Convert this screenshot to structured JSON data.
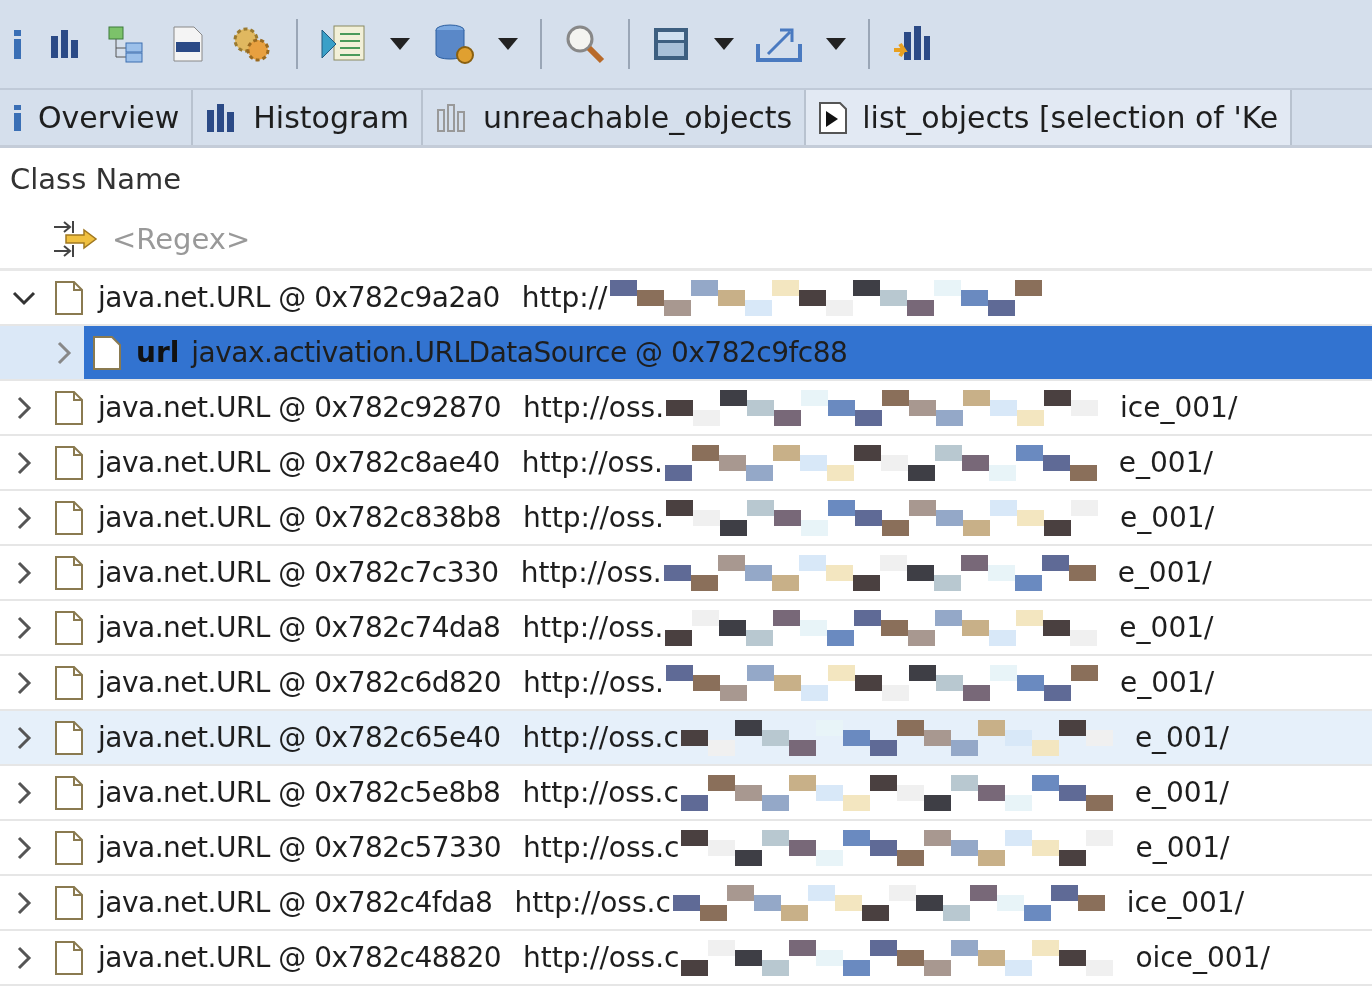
{
  "tabs": [
    {
      "kind": "info",
      "label": "Overview",
      "selected": false
    },
    {
      "kind": "histogram",
      "label": "Histogram",
      "selected": false
    },
    {
      "kind": "histogram-outline",
      "label": "unreachable_objects",
      "selected": false
    },
    {
      "kind": "list",
      "label": "list_objects [selection of 'Ke",
      "selected": true
    }
  ],
  "table": {
    "column": "Class Name",
    "filter_placeholder": "<Regex>",
    "rows": [
      {
        "name": "java.net.URL @ 0x782c9a2a0",
        "url_prefix": "http://",
        "url_suffix": "",
        "expanded": true,
        "hovered": false,
        "children": [
          {
            "field": "url",
            "name": "javax.activation.URLDataSource @ 0x782c9fc88",
            "selected": true,
            "expanded": false
          }
        ]
      },
      {
        "name": "java.net.URL @ 0x782c92870",
        "url_prefix": "http://oss.",
        "url_suffix": "ice_001/",
        "expanded": false,
        "hovered": false
      },
      {
        "name": "java.net.URL @ 0x782c8ae40",
        "url_prefix": "http://oss.",
        "url_suffix": "e_001/",
        "expanded": false,
        "hovered": false
      },
      {
        "name": "java.net.URL @ 0x782c838b8",
        "url_prefix": "http://oss.",
        "url_suffix": "e_001/",
        "expanded": false,
        "hovered": false
      },
      {
        "name": "java.net.URL @ 0x782c7c330",
        "url_prefix": "http://oss.",
        "url_suffix": "e_001/",
        "expanded": false,
        "hovered": false
      },
      {
        "name": "java.net.URL @ 0x782c74da8",
        "url_prefix": "http://oss.",
        "url_suffix": "e_001/",
        "expanded": false,
        "hovered": false
      },
      {
        "name": "java.net.URL @ 0x782c6d820",
        "url_prefix": "http://oss.",
        "url_suffix": "e_001/",
        "expanded": false,
        "hovered": false
      },
      {
        "name": "java.net.URL @ 0x782c65e40",
        "url_prefix": "http://oss.c",
        "url_suffix": "e_001/",
        "expanded": false,
        "hovered": true
      },
      {
        "name": "java.net.URL @ 0x782c5e8b8",
        "url_prefix": "http://oss.c",
        "url_suffix": "e_001/",
        "expanded": false,
        "hovered": false
      },
      {
        "name": "java.net.URL @ 0x782c57330",
        "url_prefix": "http://oss.c",
        "url_suffix": "e_001/",
        "expanded": false,
        "hovered": false
      },
      {
        "name": "java.net.URL @ 0x782c4fda8",
        "url_prefix": "http://oss.c",
        "url_suffix": "ice_001/",
        "expanded": false,
        "hovered": false
      },
      {
        "name": "java.net.URL @ 0x782c48820",
        "url_prefix": "http://oss.c",
        "url_suffix": "oice_001/",
        "expanded": false,
        "hovered": false
      }
    ]
  }
}
